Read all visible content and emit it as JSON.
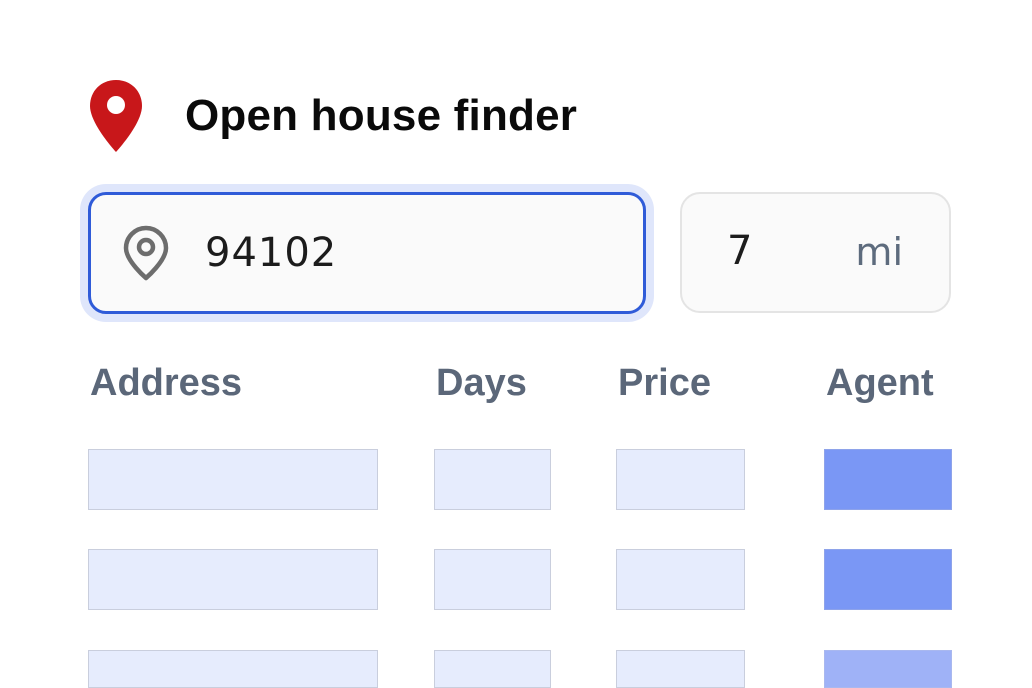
{
  "app": {
    "title": "Open house finder",
    "logo_icon": "map-pin-icon",
    "accent_color": "#2f5bd8",
    "logo_color": "#c8171a"
  },
  "search": {
    "zip_icon": "location-pin-outline-icon",
    "zip_value": "94102",
    "radius_value": "7",
    "radius_unit": "mi"
  },
  "table": {
    "columns": [
      "Address",
      "Days",
      "Price",
      "Agent"
    ],
    "rows": [
      {
        "address": "",
        "days": "",
        "price": "",
        "agent": ""
      },
      {
        "address": "",
        "days": "",
        "price": "",
        "agent": ""
      },
      {
        "address": "",
        "days": "",
        "price": "",
        "agent": ""
      }
    ]
  }
}
